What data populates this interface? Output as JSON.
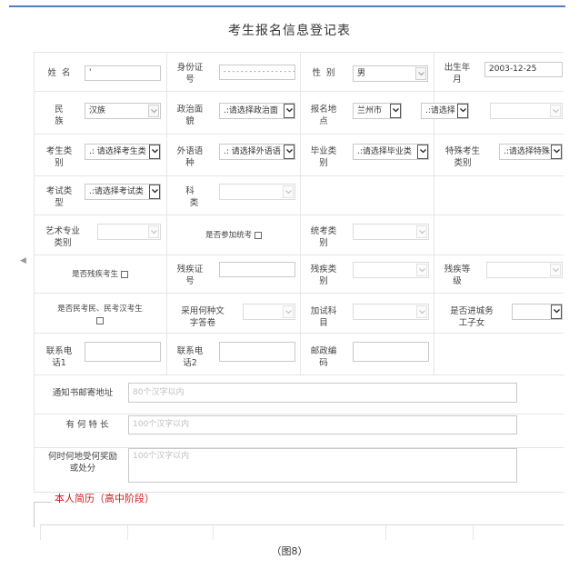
{
  "title": "考生报名信息登记表",
  "caption": "（图8）",
  "section_title": "本人简历（高中阶段）",
  "fields": {
    "name": {
      "label_1": "姓",
      "label_2": "名",
      "value": "'"
    },
    "id_number": {
      "label_1": "身份证",
      "label_2": "号",
      "value": "- - - - - - - - - - - - - - - - - 99"
    },
    "gender": {
      "label_1": "性",
      "label_2": "别",
      "value": "男"
    },
    "birth": {
      "label_1": "出生年",
      "label_2": "月",
      "value": "2003-12-25"
    },
    "ethnicity": {
      "label_1": "民",
      "label_2": "族",
      "value": "汉族"
    },
    "political": {
      "label_1": "政治面",
      "label_2": "貌",
      "value": ".:请选择政治面"
    },
    "reg_place": {
      "label_1": "报名地",
      "label_2": "点",
      "city": "兰州市",
      "district": ".:请选择",
      "third": ""
    },
    "exam_category": {
      "label_1": "考生类",
      "label_2": "别",
      "value": ".: 请选择考生类"
    },
    "foreign_lang": {
      "label_1": "外语语",
      "label_2": "种",
      "value": ".: 请选择外语语"
    },
    "grad_category": {
      "label_1": "毕业类",
      "label_2": "别",
      "value": ".:请选择毕业类"
    },
    "special_category": {
      "label_1": "特殊考生",
      "label_2": "类别",
      "value": ".:请选择特殊"
    },
    "exam_type": {
      "label_1": "考试类",
      "label_2": "型",
      "value": ".:请选择考试类"
    },
    "subject": {
      "label_1": "科",
      "label_2": "类",
      "value": ""
    },
    "art_category": {
      "label_1": "艺术专业",
      "label_2": "类别",
      "value": ""
    },
    "joint_exam": {
      "label": "是否参加统考"
    },
    "unified_category": {
      "label_1": "统考类",
      "label_2": "别",
      "value": ""
    },
    "is_disabled": {
      "label": "是否残疾考生"
    },
    "disability_cert": {
      "label_1": "残疾证",
      "label_2": "号",
      "value": ""
    },
    "disability_type": {
      "label_1": "残疾类",
      "label_2": "别",
      "value": ""
    },
    "disability_level": {
      "label_1": "残疾等",
      "label_2": "级",
      "value": ""
    },
    "minority": {
      "label": "是否民考民、民考汉考生"
    },
    "answer_lang": {
      "label_1": "采用何种文",
      "label_2": "字答卷",
      "value": ""
    },
    "extra_subject": {
      "label_1": "加试科",
      "label_2": "目",
      "value": ""
    },
    "migrant_child": {
      "label_1": "是否进城务",
      "label_2": "工子女",
      "value": ""
    },
    "phone1": {
      "label_1": "联系电",
      "label_2": "话1",
      "value": ""
    },
    "phone2": {
      "label_1": "联系电",
      "label_2": "话2",
      "value": ""
    },
    "postcode": {
      "label_1": "邮政编",
      "label_2": "码",
      "value": ""
    },
    "address": {
      "label": "通知书邮寄地址",
      "placeholder": "80个汉字以内"
    },
    "specialty": {
      "label": "有 何 特 长",
      "placeholder": "100个汉字以内"
    },
    "awards": {
      "label_1": "何时何地受何奖励",
      "label_2": "或处分",
      "placeholder": "100个汉字以内"
    }
  }
}
